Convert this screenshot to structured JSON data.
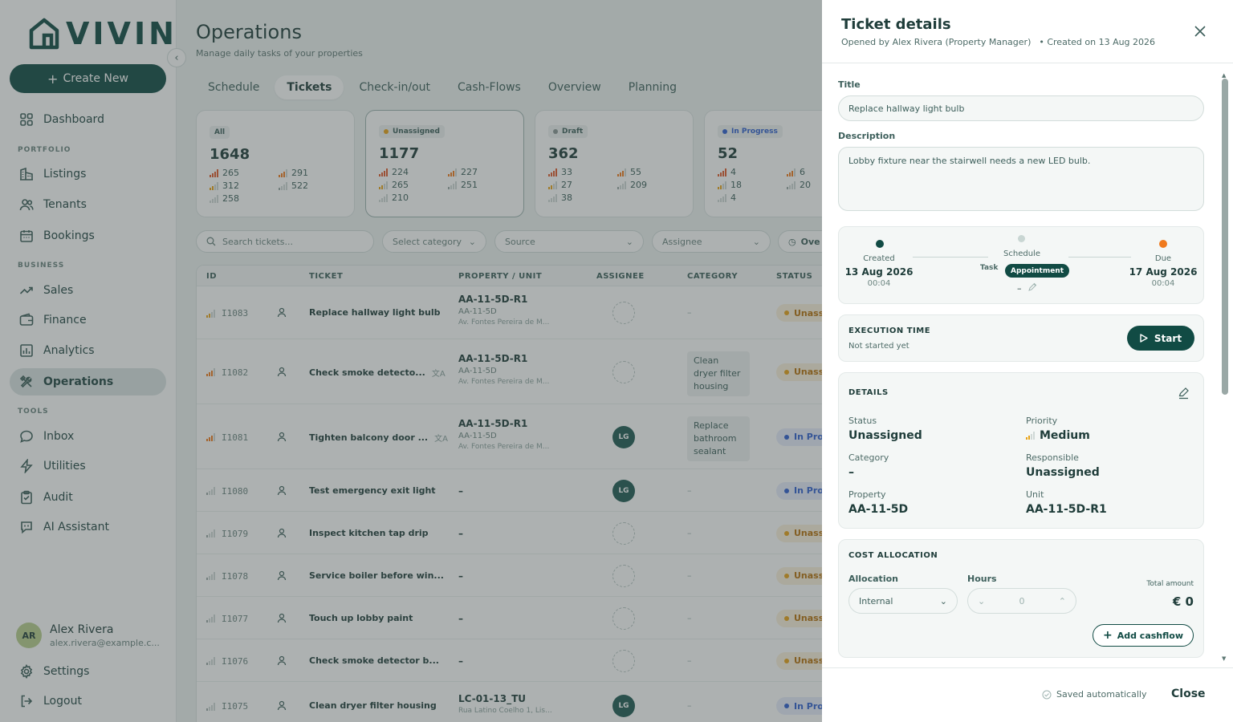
{
  "brand": {
    "logo_text": "VIVIN",
    "color": "#114b44"
  },
  "sidebar": {
    "create_label": "Create New",
    "dashboard": "Dashboard",
    "section_portfolio": "PORTFOLIO",
    "listings": "Listings",
    "tenants": "Tenants",
    "bookings": "Bookings",
    "section_business": "BUSINESS",
    "sales": "Sales",
    "finance": "Finance",
    "analytics": "Analytics",
    "operations": "Operations",
    "section_tools": "TOOLS",
    "inbox": "Inbox",
    "utilities": "Utilities",
    "audit": "Audit",
    "ai_assistant": "AI Assistant",
    "settings": "Settings",
    "logout": "Logout",
    "user": {
      "initials": "AR",
      "name": "Alex Rivera",
      "email": "alex.rivera@example.c..."
    }
  },
  "main": {
    "title": "Operations",
    "subtitle": "Manage daily tasks of your properties",
    "tabs": [
      "Schedule",
      "Tickets",
      "Check-in/out",
      "Cash-Flows",
      "Overview",
      "Planning"
    ],
    "active_tab": "Tickets",
    "cards": [
      {
        "label": "All",
        "total": "1648",
        "dot": "",
        "stats": [
          "265",
          "291",
          "312",
          "522",
          "258"
        ]
      },
      {
        "label": "Unassigned",
        "total": "1177",
        "dot": "#e8a317",
        "stats": [
          "224",
          "227",
          "265",
          "251",
          "210"
        ]
      },
      {
        "label": "Draft",
        "total": "362",
        "dot": "#8a9794",
        "stats": [
          "33",
          "55",
          "27",
          "209",
          "38"
        ]
      },
      {
        "label": "In Progress",
        "total": "52",
        "dot": "#2f5fd0",
        "stats": [
          "4",
          "6",
          "18",
          "20",
          "4"
        ]
      }
    ],
    "filters": {
      "search_placeholder": "Search tickets...",
      "category": "Select category",
      "source": "Source",
      "assignee": "Assignee",
      "overdue": "Ove"
    },
    "table": {
      "headers": {
        "id": "ID",
        "ticket": "TICKET",
        "property": "PROPERTY / UNIT",
        "assignee": "ASSIGNEE",
        "category": "CATEGORY",
        "status": "STATUS"
      },
      "rows": [
        {
          "id": "I1083",
          "ticket": "Replace hallway light bulb",
          "prop": "AA-11-5D-R1",
          "unit": "AA-11-5D",
          "addr": "Av. Fontes Pereira de M...",
          "assignee": "",
          "category": "–",
          "status": "Unass",
          "priority": "medium",
          "translate": false
        },
        {
          "id": "I1082",
          "ticket": "Check smoke detecto...",
          "prop": "AA-11-5D-R1",
          "unit": "AA-11-5D",
          "addr": "Av. Fontes Pereira de M...",
          "assignee": "",
          "category": "Clean dryer filter housing",
          "status": "Unass",
          "priority": "high",
          "translate": true
        },
        {
          "id": "I1081",
          "ticket": "Tighten balcony door ...",
          "prop": "AA-11-5D-R1",
          "unit": "AA-11-5D",
          "addr": "Av. Fontes Pereira de M...",
          "assignee": "LG",
          "category": "Replace bathroom sealant",
          "status": "In Prog",
          "priority": "high",
          "translate": true
        },
        {
          "id": "I1080",
          "ticket": "Test emergency exit light",
          "prop": "–",
          "unit": "",
          "addr": "",
          "assignee": "LG",
          "category": "–",
          "status": "In Prog",
          "priority": "low",
          "translate": false
        },
        {
          "id": "I1079",
          "ticket": "Inspect kitchen tap drip",
          "prop": "–",
          "unit": "",
          "addr": "",
          "assignee": "",
          "category": "–",
          "status": "Unass",
          "priority": "low",
          "translate": false
        },
        {
          "id": "I1078",
          "ticket": "Service boiler before win...",
          "prop": "–",
          "unit": "",
          "addr": "",
          "assignee": "",
          "category": "–",
          "status": "Unass",
          "priority": "low",
          "translate": false
        },
        {
          "id": "I1077",
          "ticket": "Touch up lobby paint",
          "prop": "–",
          "unit": "",
          "addr": "",
          "assignee": "",
          "category": "–",
          "status": "Unass",
          "priority": "low",
          "translate": false
        },
        {
          "id": "I1076",
          "ticket": "Check smoke detector b...",
          "prop": "–",
          "unit": "",
          "addr": "",
          "assignee": "",
          "category": "–",
          "status": "Unass",
          "priority": "low",
          "translate": false
        },
        {
          "id": "I1075",
          "ticket": "Clean dryer filter housing",
          "prop": "LC-01-13_TU",
          "unit": "",
          "addr": "Rua Latino Coelho 1, Lis...",
          "assignee": "LG",
          "category": "–",
          "status": "In Prog",
          "priority": "low",
          "translate": false
        }
      ]
    }
  },
  "panel": {
    "title": "Ticket details",
    "opened_by": "Opened by Alex Rivera (Property Manager)",
    "created_on": "• Created on 13 Aug 2026",
    "title_label": "Title",
    "title_value": "Replace hallway light bulb",
    "description_label": "Description",
    "description_value": "Lobby fixture near the stairwell needs a new LED bulb.",
    "timeline": {
      "created_label": "Created",
      "created_date": "13 Aug 2026",
      "created_time": "00:04",
      "schedule_label": "Schedule",
      "task_label": "Task",
      "appointment_label": "Appointment",
      "schedule_value": "–",
      "due_label": "Due",
      "due_date": "17 Aug 2026",
      "due_time": "00:04"
    },
    "execution": {
      "title": "EXECUTION TIME",
      "value": "Not started yet",
      "start_label": "Start"
    },
    "details": {
      "title": "DETAILS",
      "status_label": "Status",
      "status_value": "Unassigned",
      "priority_label": "Priority",
      "priority_value": "Medium",
      "category_label": "Category",
      "category_value": "–",
      "responsible_label": "Responsible",
      "responsible_value": "Unassigned",
      "property_label": "Property",
      "property_value": "AA-11-5D",
      "unit_label": "Unit",
      "unit_value": "AA-11-5D-R1"
    },
    "cost": {
      "title": "COST ALLOCATION",
      "allocation_label": "Allocation",
      "allocation_value": "Internal",
      "hours_label": "Hours",
      "hours_value": "0",
      "total_label": "Total amount",
      "total_value": "€ 0",
      "add_cashflow": "Add cashflow"
    },
    "footer": {
      "saved": "Saved automatically",
      "close": "Close"
    }
  },
  "colors": {
    "accent": "#114b44",
    "unassigned": "#e8a317",
    "in_progress": "#2f5fd0",
    "due": "#f07a1e",
    "high": "#e05a2b"
  }
}
